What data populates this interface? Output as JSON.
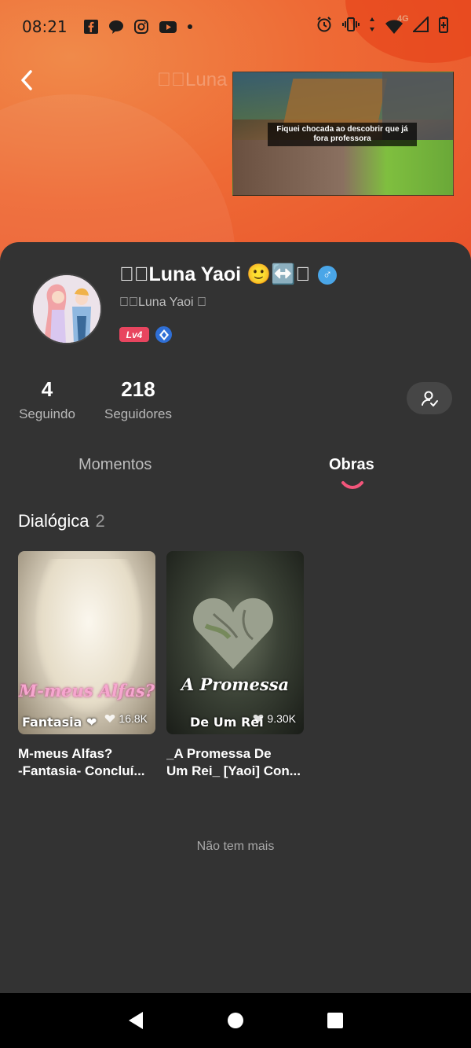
{
  "status_bar": {
    "time": "08:21",
    "network": "4G",
    "left_icons": [
      "facebook-icon",
      "chat-bubble-icon",
      "instagram-icon",
      "youtube-icon",
      "dot-icon"
    ],
    "right_icons": [
      "alarm-icon",
      "vibrate-icon",
      "data-arrows-icon",
      "wifi-icon",
      "signal-icon",
      "battery-icon"
    ]
  },
  "header": {
    "faded_title": "\u0000\u0000Luna Y"
  },
  "video": {
    "caption_line1": "Fiquei chocada ao descobrir que já",
    "caption_line2": "fora professora"
  },
  "profile": {
    "name": "\u0000\u0000Luna Yaoi 🙂↔️\u0000",
    "subname": "\u0000\u0000Luna Yaoi \u0000",
    "level": "Lv4",
    "gender_symbol": "♂"
  },
  "stats": {
    "following_count": "4",
    "following_label": "Seguindo",
    "followers_count": "218",
    "followers_label": "Seguidores"
  },
  "tabs": {
    "moments": "Momentos",
    "works": "Obras",
    "active": "Obras"
  },
  "section": {
    "title": "Dialógica",
    "count": "2"
  },
  "works": [
    {
      "cover_title": "M-meus Alfas?",
      "cover_sub": "Fantasia ❤",
      "views": "16.8K",
      "title_line1": "M-meus Alfas?",
      "title_line2": "-Fantasia- Concluí..."
    },
    {
      "cover_title": "A Promessa",
      "cover_sub": "De Um Rei",
      "views": "9.30K",
      "title_line1": "_A Promessa De",
      "title_line2": "Um Rei_ [Yaoi] Con..."
    }
  ],
  "footer": {
    "no_more": "Não tem mais"
  },
  "colors": {
    "hero_orange": "#ee6a35",
    "sheet_bg": "#333333",
    "level_badge": "#e8455f",
    "tab_indicator": "#f2557a",
    "gender_badge": "#4aa6e8"
  }
}
